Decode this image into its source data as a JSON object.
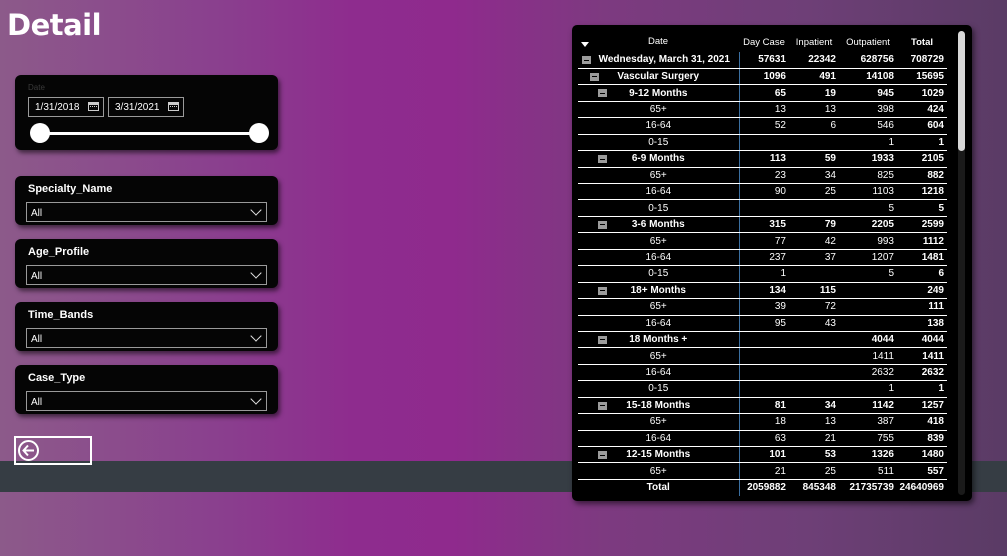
{
  "page": {
    "title": "Detail",
    "back_label": ""
  },
  "colors": {
    "card_bg": "#050505",
    "band": "#363d44",
    "divider": "#3b6fa0"
  },
  "date_filter": {
    "label": "Date",
    "start": "1/31/2018",
    "end": "3/31/2021",
    "range_start_fraction": 0,
    "range_end_fraction": 1
  },
  "filters": [
    {
      "label": "Specialty_Name",
      "value": "All"
    },
    {
      "label": "Age_Profile",
      "value": "All"
    },
    {
      "label": "Time_Bands",
      "value": "All"
    },
    {
      "label": "Case_Type",
      "value": "All"
    }
  ],
  "matrix": {
    "columns": [
      "Date",
      "Day Case",
      "Inpatient",
      "Outpatient",
      "Total"
    ],
    "rows": [
      {
        "level": 0,
        "label": "Wednesday, March 31, 2021",
        "values": [
          "57631",
          "22342",
          "628756",
          "708729"
        ]
      },
      {
        "level": 1,
        "label": "Vascular Surgery",
        "values": [
          "1096",
          "491",
          "14108",
          "15695"
        ]
      },
      {
        "level": 2,
        "label": "9-12 Months",
        "values": [
          "65",
          "19",
          "945",
          "1029"
        ]
      },
      {
        "level": 3,
        "label": "65+",
        "values": [
          "13",
          "13",
          "398",
          "424"
        ]
      },
      {
        "level": 3,
        "label": "16-64",
        "values": [
          "52",
          "6",
          "546",
          "604"
        ]
      },
      {
        "level": 3,
        "label": "0-15",
        "values": [
          "",
          "",
          "1",
          "1"
        ]
      },
      {
        "level": 2,
        "label": "6-9 Months",
        "values": [
          "113",
          "59",
          "1933",
          "2105"
        ]
      },
      {
        "level": 3,
        "label": "65+",
        "values": [
          "23",
          "34",
          "825",
          "882"
        ]
      },
      {
        "level": 3,
        "label": "16-64",
        "values": [
          "90",
          "25",
          "1103",
          "1218"
        ]
      },
      {
        "level": 3,
        "label": "0-15",
        "values": [
          "",
          "",
          "5",
          "5"
        ]
      },
      {
        "level": 2,
        "label": "3-6 Months",
        "values": [
          "315",
          "79",
          "2205",
          "2599"
        ]
      },
      {
        "level": 3,
        "label": "65+",
        "values": [
          "77",
          "42",
          "993",
          "1112"
        ]
      },
      {
        "level": 3,
        "label": "16-64",
        "values": [
          "237",
          "37",
          "1207",
          "1481"
        ]
      },
      {
        "level": 3,
        "label": "0-15",
        "values": [
          "1",
          "",
          "5",
          "6"
        ]
      },
      {
        "level": 2,
        "label": "18+ Months",
        "values": [
          "134",
          "115",
          "",
          "249"
        ]
      },
      {
        "level": 3,
        "label": "65+",
        "values": [
          "39",
          "72",
          "",
          "111"
        ]
      },
      {
        "level": 3,
        "label": "16-64",
        "values": [
          "95",
          "43",
          "",
          "138"
        ]
      },
      {
        "level": 2,
        "label": "18 Months +",
        "values": [
          "",
          "",
          "4044",
          "4044"
        ]
      },
      {
        "level": 3,
        "label": "65+",
        "values": [
          "",
          "",
          "1411",
          "1411"
        ]
      },
      {
        "level": 3,
        "label": "16-64",
        "values": [
          "",
          "",
          "2632",
          "2632"
        ]
      },
      {
        "level": 3,
        "label": "0-15",
        "values": [
          "",
          "",
          "1",
          "1"
        ]
      },
      {
        "level": 2,
        "label": "15-18 Months",
        "values": [
          "81",
          "34",
          "1142",
          "1257"
        ]
      },
      {
        "level": 3,
        "label": "65+",
        "values": [
          "18",
          "13",
          "387",
          "418"
        ]
      },
      {
        "level": 3,
        "label": "16-64",
        "values": [
          "63",
          "21",
          "755",
          "839"
        ]
      },
      {
        "level": 2,
        "label": "12-15 Months",
        "values": [
          "101",
          "53",
          "1326",
          "1480"
        ]
      },
      {
        "level": 3,
        "label": "65+",
        "values": [
          "21",
          "25",
          "511",
          "557"
        ]
      }
    ],
    "total": {
      "label": "Total",
      "values": [
        "2059882",
        "845348",
        "21735739",
        "24640969"
      ]
    }
  }
}
